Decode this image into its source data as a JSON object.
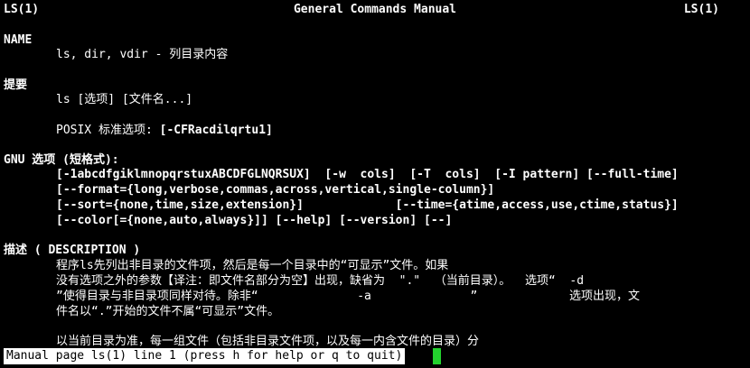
{
  "header": {
    "left": "LS(1)",
    "center": "General Commands Manual",
    "right": "LS(1)"
  },
  "name_section": {
    "heading": "NAME",
    "text": "ls, dir, vdir - 列目录内容"
  },
  "synopsis": {
    "heading": "提要",
    "usage": "ls [选项] [文件名...]",
    "posix_label": "POSIX 标准选项: ",
    "posix_options": "[-CFRacdilqrtu1]"
  },
  "gnu": {
    "heading": "GNU 选项 (短格式):",
    "lines": [
      "[-1abcdfgiklmnopqrstuxABCDFGLNQRSUX]  [-w  cols]  [-T  cols]  [-I pattern] [--full-time]",
      "[--format={long,verbose,commas,across,vertical,single-column}]",
      "[--sort={none,time,size,extension}]             [--time={atime,access,use,ctime,status}]",
      "[--color[={none,auto,always}]] [--help] [--version] [--]"
    ]
  },
  "description": {
    "heading": "描述 ( DESCRIPTION )",
    "lines": [
      "程序ls先列出非目录的文件项，然后是每一个目录中的“可显示”文件。如果",
      "没有选项之外的参数【译注：即文件名部分为空】出现，缺省为  \".\"  （当前目录）。  选项“  -d",
      "”使得目录与非目录项同样对待。除非“              -a              ”             选项出现，文",
      "件名以“.”开始的文件不属“可显示”文件。",
      "",
      "以当前目录为准，每一组文件（包括非目录文件项，以及每一内含文件的目录）分"
    ]
  },
  "status_bar": {
    "text": "Manual page ls(1) line 1 (press h for help or q to quit)"
  },
  "colors": {
    "background": "#000000",
    "foreground": "#ffffff",
    "cursor": "#23d12e"
  }
}
